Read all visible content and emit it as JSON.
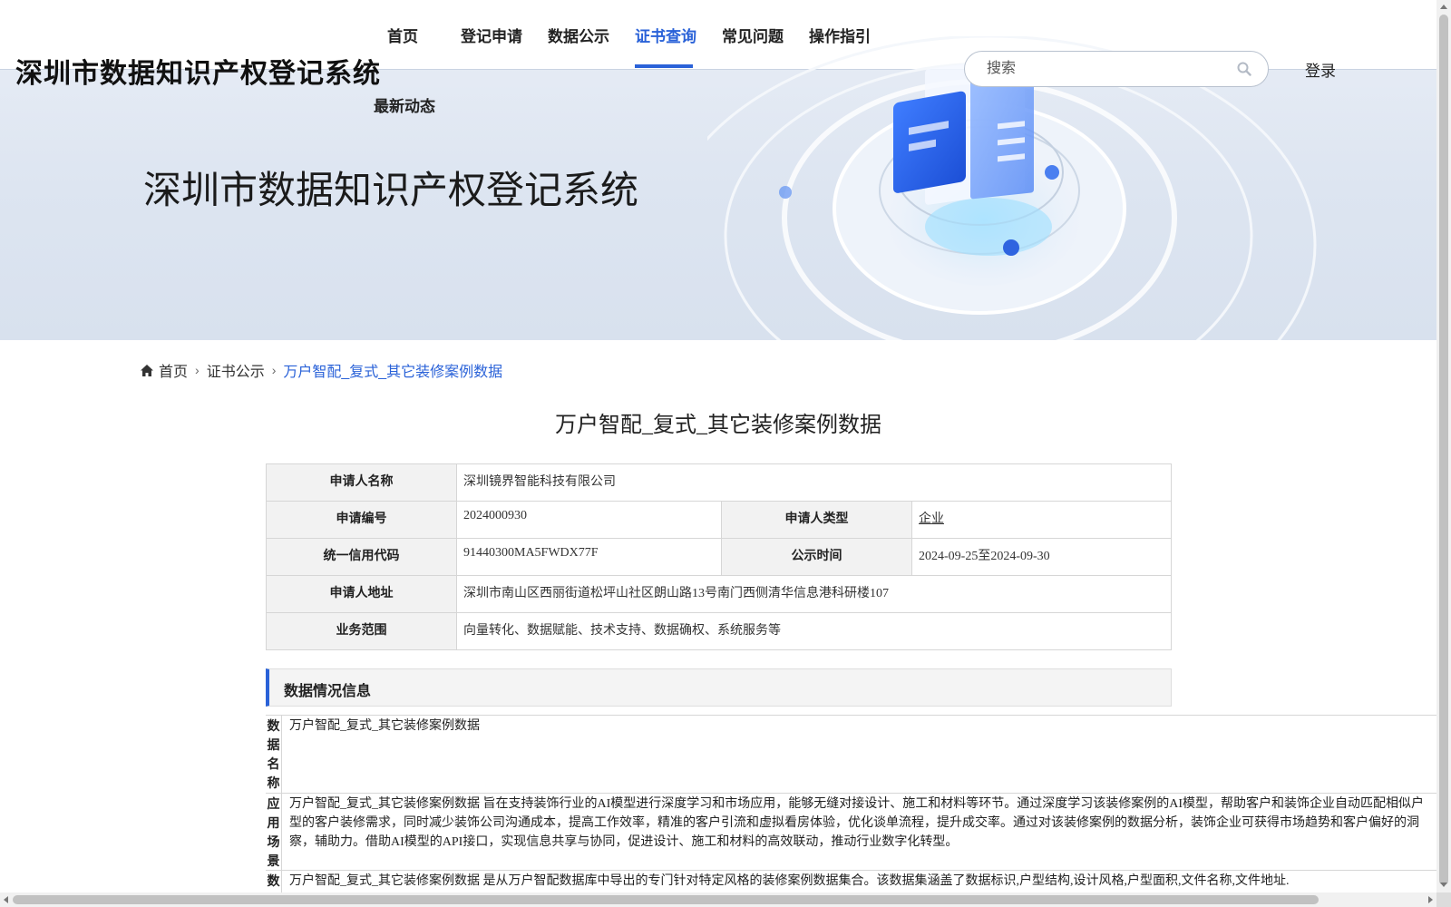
{
  "header": {
    "site_title": "深圳市数据知识产权登记系统",
    "hero_title": "深圳市数据知识产权登记系统"
  },
  "nav": {
    "items": [
      {
        "label": "首页"
      },
      {
        "label": "登记申请"
      },
      {
        "label": "数据公示"
      },
      {
        "label": "证书查询",
        "active": true
      },
      {
        "label": "常见问题"
      },
      {
        "label": "操作指引"
      },
      {
        "label": "最新动态"
      }
    ]
  },
  "search": {
    "placeholder": "搜索",
    "icon": "search-icon"
  },
  "login_label": "登录",
  "breadcrumb": {
    "home": "首页",
    "level1": "证书公示",
    "current": "万户智配_复式_其它装修案例数据"
  },
  "page_title": "万户智配_复式_其它装修案例数据",
  "applicant": {
    "name_label": "申请人名称",
    "name_value": "深圳镜界智能科技有限公司",
    "number_label": "申请编号",
    "number_value": "2024000930",
    "type_label": "申请人类型",
    "type_value": "企业",
    "credit_label": "统一信用代码",
    "credit_value": "91440300MA5FWDX77F",
    "publicity_label": "公示时间",
    "publicity_value": "2024-09-25至2024-09-30",
    "address_label": "申请人地址",
    "address_value": "深圳市南山区西丽街道松坪山社区朗山路13号南门西侧清华信息港科研楼107",
    "scope_label": "业务范围",
    "scope_value": "向量转化、数据赋能、技术支持、数据确权、系统服务等"
  },
  "data_section": {
    "title": "数据情况信息",
    "rows": [
      {
        "label": "数据名称",
        "value": "万户智配_复式_其它装修案例数据"
      },
      {
        "label": "应用场景",
        "value": "万户智配_复式_其它装修案例数据 旨在支持装饰行业的AI模型进行深度学习和市场应用，能够无缝对接设计、施工和材料等环节。通过深度学习该装修案例的AI模型，帮助客户和装饰企业自动匹配相似户型的客户装修需求，同时减少装饰公司沟通成本，提高工作效率，精准的客户引流和虚拟看房体验，优化谈单流程，提升成交率。通过对该装修案例的数据分析，装饰企业可获得市场趋势和客户偏好的洞察，辅助力。借助AI模型的API接口，实现信息共享与协同，促进设计、施工和材料的高效联动，推动行业数字化转型。"
      },
      {
        "label": "数据",
        "value": "万户智配_复式_其它装修案例数据 是从万户智配数据库中导出的专门针对特定风格的装修案例数据集合。该数据集涵盖了数据标识,户型结构,设计风格,户型面积,文件名称,文件地址."
      }
    ]
  },
  "colors": {
    "accent": "#2a62d8",
    "label_bg": "#f2f2f2"
  }
}
